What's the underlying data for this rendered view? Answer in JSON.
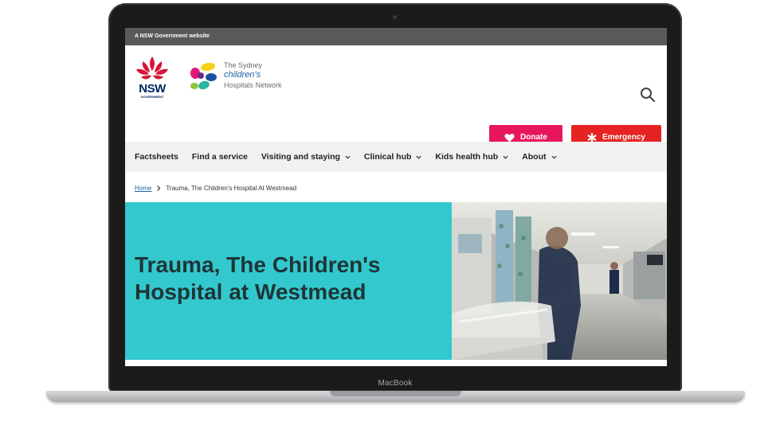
{
  "device": {
    "label": "MacBook"
  },
  "gov_bar": {
    "text": "A NSW Government website"
  },
  "header": {
    "nsw_logo": {
      "name": "NSW",
      "sub": "GOVERNMENT"
    },
    "schn_logo": {
      "line1": "The Sydney",
      "line2": "children's",
      "line3": "Hospitals Network"
    },
    "search_icon": "search-icon",
    "donate_label": "Donate",
    "emergency_label": "Emergency"
  },
  "nav": {
    "items": [
      {
        "label": "Factsheets",
        "dropdown": false
      },
      {
        "label": "Find a service",
        "dropdown": false
      },
      {
        "label": "Visiting and staying",
        "dropdown": true
      },
      {
        "label": "Clinical hub",
        "dropdown": true
      },
      {
        "label": "Kids health hub",
        "dropdown": true
      },
      {
        "label": "About",
        "dropdown": true
      }
    ]
  },
  "breadcrumb": {
    "home": "Home",
    "current": "Trauma, The Children's Hospital At Westmead"
  },
  "hero": {
    "title": "Trauma, The Children's Hospital at Westmead",
    "background_color": "#33c8ce"
  },
  "colors": {
    "donate": "#e8175d",
    "emergency": "#e52322",
    "gov_bar": "#58595b",
    "nsw_blue": "#002664"
  }
}
